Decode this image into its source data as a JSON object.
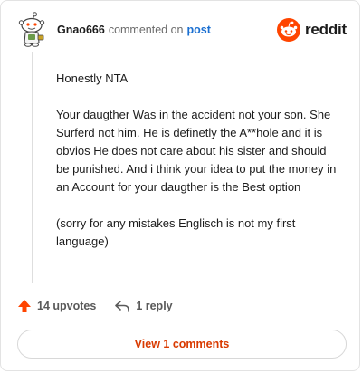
{
  "comment": {
    "username": "Gnao666",
    "byline_text": "commented on",
    "post_link": "post",
    "paragraphs": [
      "Honestly NTA",
      "Your daugther Was in the accident not your son. She Surferd not him. He is definetly the A**hole and it is obvios He does not care about his sister and should be punished. And i think your idea to put the money in an Account for your daugther is the Best option",
      "(sorry for any mistakes Englisch is not my first language)"
    ]
  },
  "brand": {
    "wordmark": "reddit",
    "icon": "reddit-logo-icon",
    "color": "#ff4500"
  },
  "actions": {
    "upvotes_label": "14 upvotes",
    "upvote_icon": "upvote-arrow-icon",
    "upvote_color": "#ff4500",
    "reply_label": "1 reply",
    "reply_icon": "reply-icon"
  },
  "view_button": {
    "label": "View 1 comments",
    "color": "#d93a00"
  }
}
